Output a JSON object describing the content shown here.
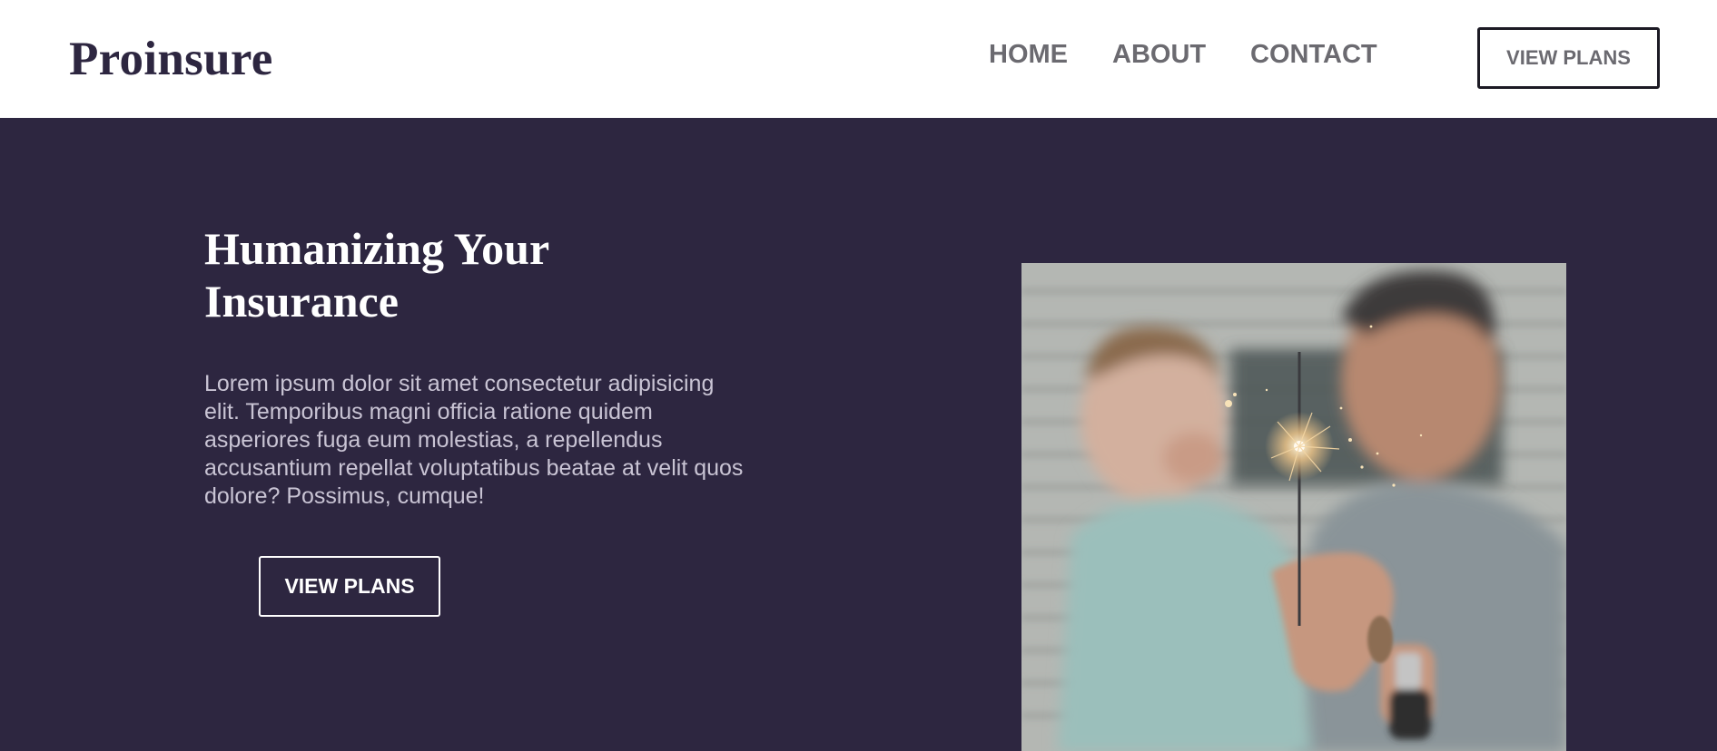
{
  "header": {
    "logo": "Proinsure",
    "nav": [
      {
        "label": "HOME"
      },
      {
        "label": "ABOUT"
      },
      {
        "label": "CONTACT"
      }
    ],
    "cta_label": "VIEW PLANS"
  },
  "hero": {
    "title": "Humanizing Your Insurance",
    "body": "Lorem ipsum dolor sit amet consectetur adipisicing elit. Temporibus magni officia ratione quidem asperiores fuga eum molestias, a repellendus accusantium repellat voluptatibus beatae at velit quos dolore? Possimus, cumque!",
    "cta_label": "VIEW PLANS"
  },
  "colors": {
    "brand_dark": "#2d2640",
    "nav_gray": "#6b6a70",
    "white": "#ffffff"
  },
  "icons": {
    "hero_image": "photo-father-child-sparkler"
  }
}
